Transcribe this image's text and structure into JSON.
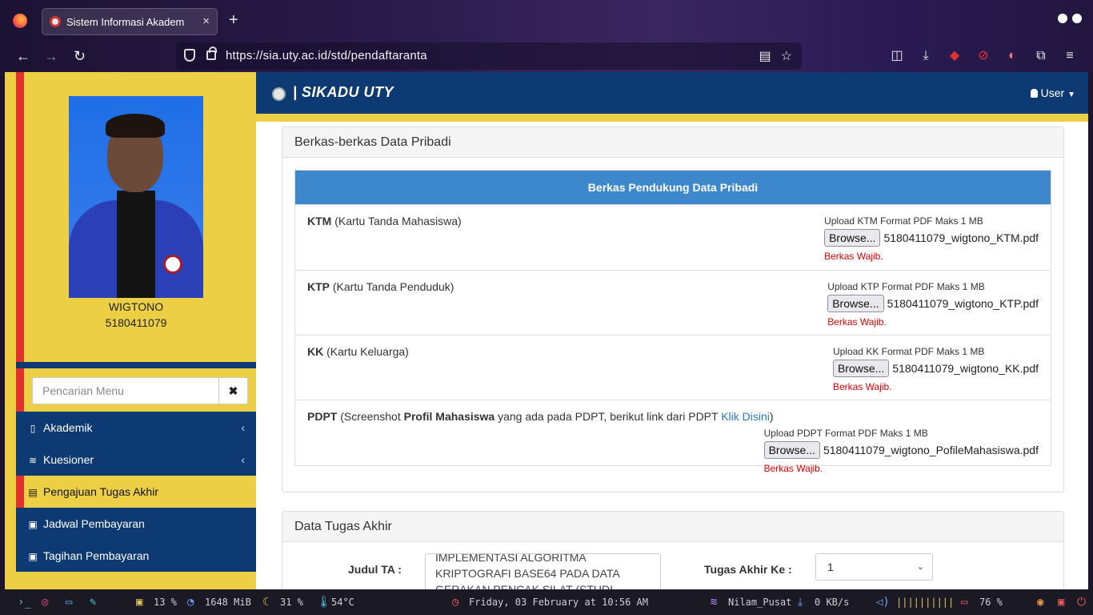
{
  "browser": {
    "tab_title": "Sistem Informasi Akadem",
    "tab_close": "×",
    "new_tab": "+",
    "url": "https://sia.uty.ac.id/std/pendaftaranta",
    "ext_badge": "1"
  },
  "header": {
    "brand": "| SIKADU UTY",
    "user_label": "User"
  },
  "profile": {
    "name": "WIGTONO",
    "nim": "5180411079"
  },
  "sidebar": {
    "search_placeholder": "Pencarian Menu",
    "clear_label": "✖",
    "items": [
      {
        "label": "Akademik",
        "icon": "▯",
        "caret": "‹"
      },
      {
        "label": "Kuesioner",
        "icon": "≋",
        "caret": "‹"
      },
      {
        "label": "Pengajuan Tugas Akhir",
        "icon": "▤"
      },
      {
        "label": "Jadwal Pembayaran",
        "icon": "▣"
      },
      {
        "label": "Tagihan Pembayaran",
        "icon": "▣"
      }
    ]
  },
  "berkas": {
    "panel_title": "Berkas-berkas Data Pribadi",
    "table_header": "Berkas Pendukung Data Pribadi",
    "browse_label": "Browse...",
    "wajib_label": "Berkas Wajib.",
    "rows": [
      {
        "code": "KTM",
        "desc": "(Kartu Tanda Mahasiswa)",
        "caption": "Upload KTM Format PDF Maks 1 MB",
        "file": "5180411079_wigtono_KTM.pdf"
      },
      {
        "code": "KTP",
        "desc": "(Kartu Tanda Penduduk)",
        "caption": "Upload KTP Format PDF Maks 1 MB",
        "file": "5180411079_wigtono_KTP.pdf"
      },
      {
        "code": "KK",
        "desc": "(Kartu Keluarga)",
        "caption": "Upload KK Format PDF Maks 1 MB",
        "file": "5180411079_wigtono_KK.pdf"
      },
      {
        "code": "PDPT",
        "desc_pre": "(Screenshot ",
        "desc_bold": "Profil Mahasiswa",
        "desc_mid": " yang ada pada PDPT, berikut link dari PDPT ",
        "link": "Klik Disini",
        "desc_post": ")",
        "caption": "Upload PDPT Format PDF Maks 1 MB",
        "file": "5180411079_wigtono_PofileMahasiswa.pdf"
      }
    ]
  },
  "tugas_akhir": {
    "panel_title": "Data Tugas Akhir",
    "judul_label": "Judul TA :",
    "judul_lines": [
      "IMPLEMENTASI ALGORITMA",
      "KRIPTOGRAFI BASE64 PADA DATA",
      "GERAKAN PENCAK SILAT (STUDI KASUS"
    ],
    "ke_label": "Tugas Akhir Ke :",
    "ke_value": "1"
  },
  "taskbar": {
    "cpu": "13 %",
    "mem": "1648 MiB",
    "disk": "31 %",
    "temp": "54°C",
    "datetime": "Friday, 03 February at 10:56 AM",
    "wifi": "Nilam_Pusat",
    "net": "0 KB/s",
    "volume_bars": "||||||||||",
    "battery": "76 %"
  }
}
